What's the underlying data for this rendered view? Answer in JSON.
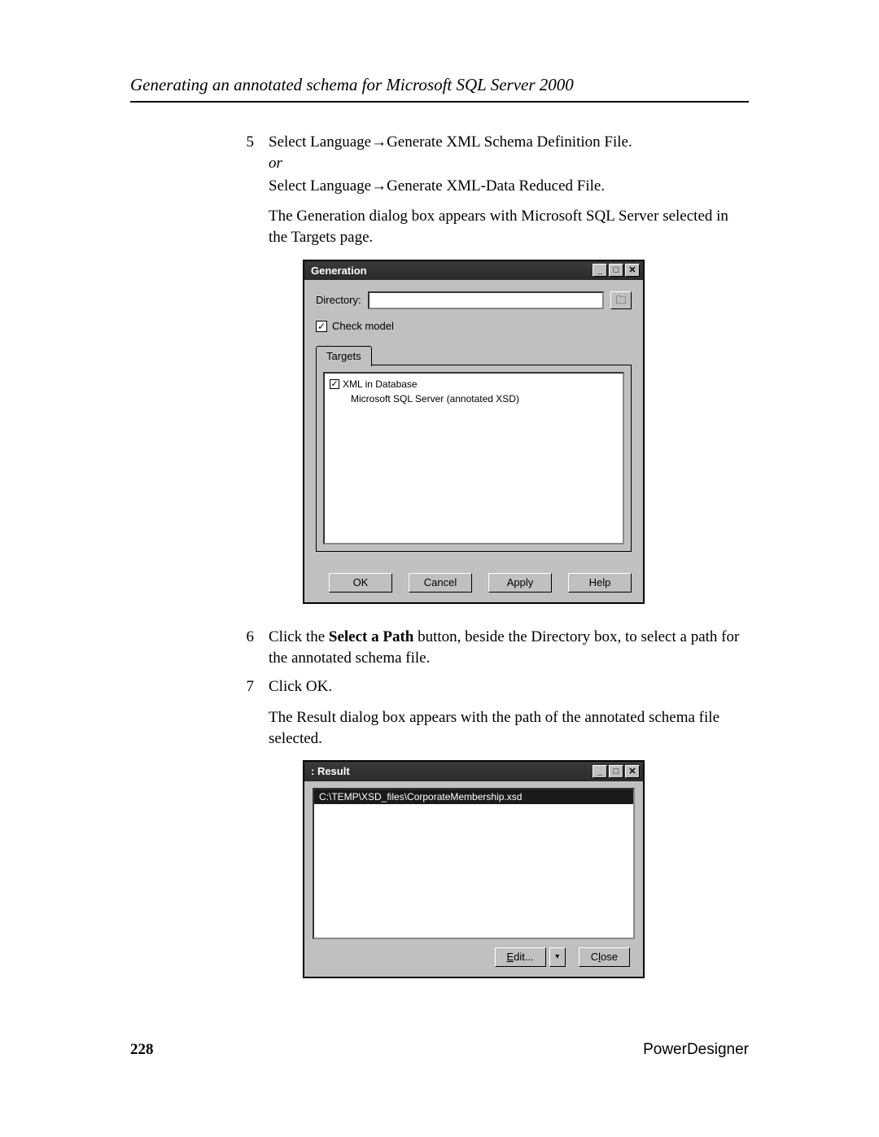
{
  "header": {
    "title": "Generating an annotated schema for Microsoft SQL Server 2000"
  },
  "steps": {
    "s5": {
      "num": "5",
      "line1": "Select Language→Generate XML Schema Definition File.",
      "or_word": "or",
      "line2": "Select Language→Generate XML-Data Reduced File.",
      "para": "The Generation dialog box appears with Microsoft SQL Server selected in the Targets page."
    },
    "s6": {
      "num": "6",
      "pre": "Click the ",
      "bold": "Select a Path",
      "post": " button, beside the Directory box, to select a path for the annotated schema file."
    },
    "s7": {
      "num": "7",
      "line": "Click OK.",
      "para": "The Result dialog box appears with the path of the annotated schema file selected."
    }
  },
  "dialog1": {
    "title": "Generation",
    "directory_label": "Directory:",
    "directory_value": "",
    "check_model_label": "Check model",
    "tab_label": "Targets",
    "tree": {
      "root": "XML in Database",
      "child": "Microsoft SQL Server (annotated XSD)"
    },
    "buttons": {
      "ok": "OK",
      "cancel": "Cancel",
      "apply": "Apply",
      "help": "Help"
    }
  },
  "dialog2": {
    "title": ": Result",
    "selected_path": "C:\\TEMP\\XSD_files\\CorporateMembership.xsd",
    "buttons": {
      "edit": "Edit...",
      "close": "Close"
    }
  },
  "footer": {
    "page": "228",
    "brand": "PowerDesigner"
  }
}
